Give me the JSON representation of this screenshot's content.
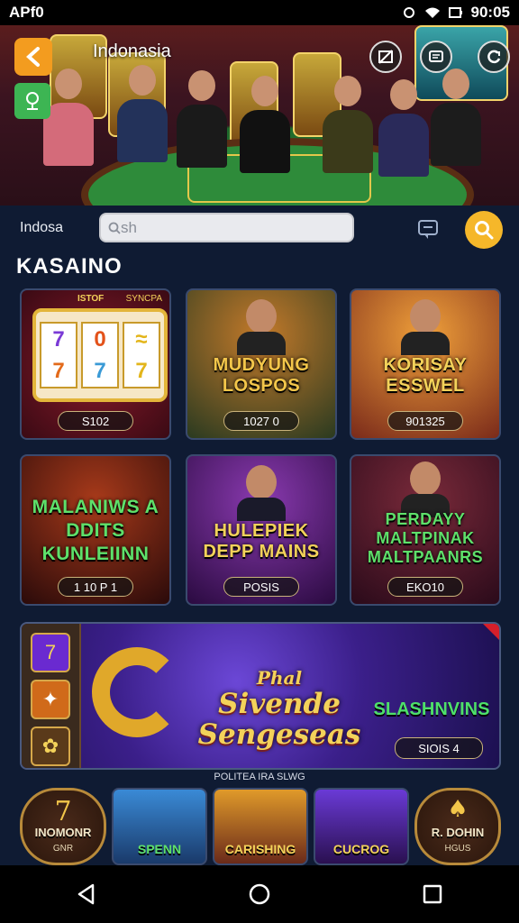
{
  "status_bar": {
    "carrier": "APf0",
    "time": "90:05"
  },
  "hero": {
    "title": "Indonasia"
  },
  "search": {
    "label": "Indosa",
    "value": "sh",
    "placeholder": ""
  },
  "section": {
    "title": "KASAINO"
  },
  "cards": [
    {
      "title": "",
      "pill": "S102",
      "tag_left": "ISTOF",
      "tag_right": "SYNCPA"
    },
    {
      "title": "MUDYUNG LOSPOS",
      "pill": "1027 0"
    },
    {
      "title": "KORISAY ESSWEL",
      "pill": "901325"
    },
    {
      "title": "MALANIWS A DDITS KUNLEIINN",
      "pill": "1 10 P 1"
    },
    {
      "title": "HULEPIEK DEPP MAINS",
      "pill": "POSIS"
    },
    {
      "title": "PERDAYY MALTPINAK MALTPAANRS",
      "pill": "EKO10"
    }
  ],
  "banner": {
    "title_line1": "Phal",
    "title_line2": "Sivende Sengeseas",
    "title2": "SLASHNVINS",
    "pill": "SIOIS 4"
  },
  "caption": "POLITEA IRA SLWG",
  "bottom_tiles": [
    {
      "number": "7",
      "title": "INOMONR",
      "sub": "GNR"
    },
    {
      "title": "SPENN"
    },
    {
      "title": "CARISHING"
    },
    {
      "title": "CUCROG"
    },
    {
      "title": "R. DOHIN",
      "sub": "HGUS"
    }
  ],
  "colors": {
    "accent_orange": "#f39c1f",
    "search_yellow": "#f5b72a",
    "bg": "#0f1b33",
    "green": "#3db553"
  }
}
